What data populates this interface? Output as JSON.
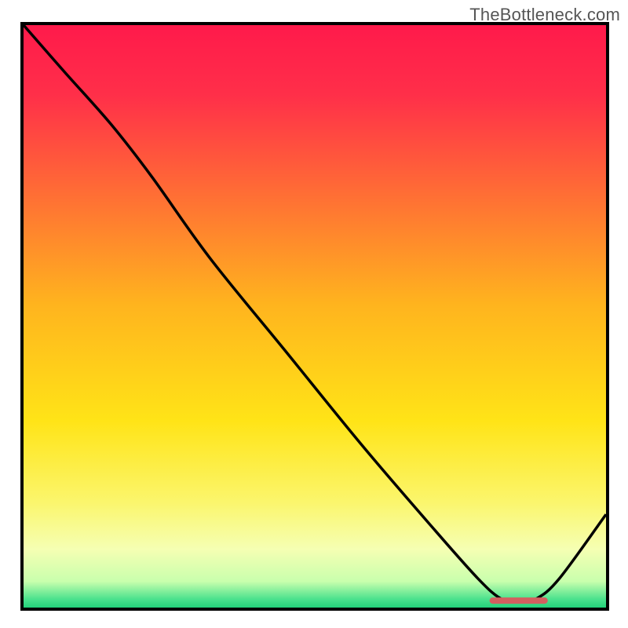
{
  "watermark": "TheBottleneck.com",
  "colors": {
    "frame_border": "#000000",
    "curve": "#000000",
    "marker": "#d35f5f",
    "gradient_stops": [
      {
        "pos": 0.0,
        "color": "#ff1a4b"
      },
      {
        "pos": 0.12,
        "color": "#ff2f49"
      },
      {
        "pos": 0.28,
        "color": "#ff6a36"
      },
      {
        "pos": 0.48,
        "color": "#ffb41e"
      },
      {
        "pos": 0.68,
        "color": "#ffe417"
      },
      {
        "pos": 0.82,
        "color": "#fbf66d"
      },
      {
        "pos": 0.9,
        "color": "#f5ffb3"
      },
      {
        "pos": 0.955,
        "color": "#c9ffad"
      },
      {
        "pos": 0.985,
        "color": "#4de28e"
      },
      {
        "pos": 1.0,
        "color": "#22d27b"
      }
    ]
  },
  "chart_data": {
    "type": "line",
    "title": "",
    "xlabel": "",
    "ylabel": "",
    "xlim": [
      0,
      100
    ],
    "ylim": [
      0,
      100
    ],
    "x": [
      0,
      7,
      15,
      22,
      32,
      45,
      58,
      70,
      78,
      82,
      85,
      88,
      92,
      100
    ],
    "values": [
      100,
      92,
      83,
      74,
      60,
      44,
      28,
      14,
      5,
      1.5,
      1,
      1.5,
      5,
      16
    ],
    "marker_range": {
      "x_start": 80,
      "x_end": 90,
      "y": 1.2
    }
  }
}
